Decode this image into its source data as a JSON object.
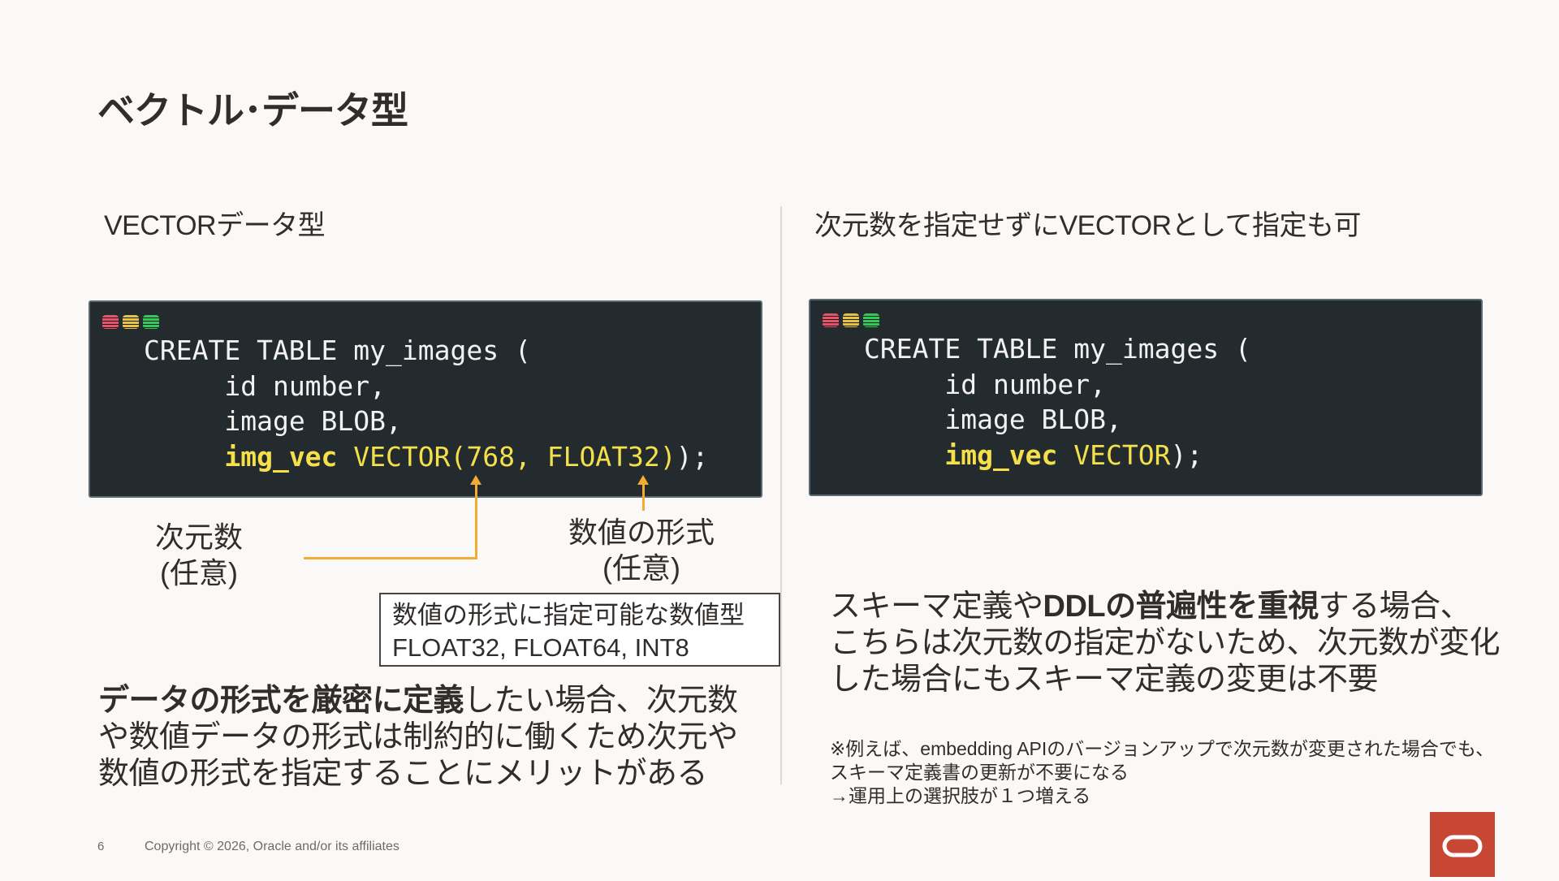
{
  "slide": {
    "title": "ベクトル･データ型",
    "page_number": "6",
    "copyright": "Copyright © 2026, Oracle and/or its affiliates"
  },
  "left": {
    "subhead": "VECTORデータ型",
    "code": {
      "line1": "CREATE TABLE my_images (",
      "line2": "id number,",
      "line3": "image BLOB,",
      "line4_col": "img_vec",
      "line4_type": "VECTOR(768, FLOAT32)",
      "line4_end": ");"
    },
    "callouts": {
      "dimension_line1": "次元数",
      "dimension_line2": "(任意)",
      "format_line1": "数値の形式",
      "format_line2": "(任意)"
    },
    "note_box": {
      "line1": "数値の形式に指定可能な数値型",
      "line2": "FLOAT32, FLOAT64, INT8"
    },
    "body": {
      "bold": "データの形式を厳密に定義",
      "rest_line1": "したい場合、次元数",
      "line2": "や数値データの形式は制約的に働くため次元や",
      "line3": "数値の形式を指定することにメリットがある"
    }
  },
  "right": {
    "subhead": "次元数を指定せずにVECTORとして指定も可",
    "code": {
      "line1": "CREATE TABLE my_images (",
      "line2": "id number,",
      "line3": "image BLOB,",
      "line4_col": "img_vec",
      "line4_type": "VECTOR",
      "line4_end": ");"
    },
    "body": {
      "pre": "スキーマ定義や",
      "bold": "DDLの普遍性を重視",
      "post_line1": "する場合、",
      "line2": "こちらは次元数の指定がないため、次元数が変化",
      "line3": "した場合にもスキーマ定義の変更は不要"
    },
    "footnote": {
      "line1": "※例えば、embedding APIのバージョンアップで次元数が変更された場合でも、",
      "line2": "スキーマ定義書の更新が不要になる",
      "line3": "→運用上の選択肢が１つ増える"
    }
  },
  "colors": {
    "accent_arrow": "#f0ad2f",
    "code_bg": "#232b2f",
    "code_keyword": "#f5e04b",
    "brand": "#c74634"
  }
}
